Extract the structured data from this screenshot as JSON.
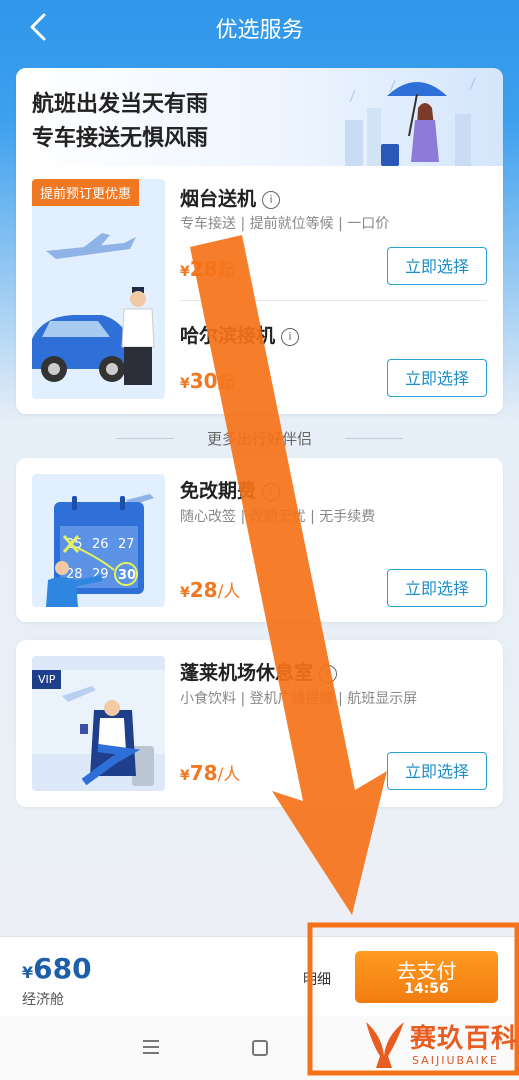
{
  "header": {
    "title": "优选服务",
    "back_icon": "chevron-left-icon"
  },
  "banner": {
    "line1": "航班出发当天有雨",
    "line2": "专车接送无惧风雨"
  },
  "services": [
    {
      "tag": "提前预订更优惠",
      "name": "烟台送机",
      "desc": "专车接送 | 提前就位等候 | 一口价",
      "price": "28",
      "price_suffix": "起",
      "button": "立即选择"
    },
    {
      "name": "哈尔滨接机",
      "price": "30",
      "price_suffix": "起",
      "button": "立即选择"
    }
  ],
  "separator": "更多出行好伴侣",
  "addons": [
    {
      "name": "免改期费",
      "desc": "随心改签 | 改期无忧 | 无手续费",
      "price": "28",
      "unit": "/人",
      "button": "立即选择",
      "calendar": [
        "25",
        "26",
        "27",
        "28",
        "29",
        "30"
      ]
    },
    {
      "name": "蓬莱机场休息室",
      "desc": "小食饮料 | 登机广播提醒 | 航班显示屏",
      "price": "78",
      "unit": "/人",
      "button": "立即选择",
      "badge": "VIP"
    }
  ],
  "footer": {
    "currency": "¥",
    "total": "680",
    "cabin": "经济舱",
    "detail": "明细",
    "pay_label": "去支付",
    "timer": "14:56"
  },
  "navbar": {
    "menu_icon": "menu-icon",
    "home_icon": "home-icon"
  },
  "watermark": {
    "text": "赛玖百科",
    "sub": "SAIJIUBAIKE"
  },
  "colors": {
    "header_blue": "#2f96ea",
    "accent_orange": "#f07823",
    "button_blue": "#27a2d6",
    "price_blue": "#1d5fa8"
  }
}
